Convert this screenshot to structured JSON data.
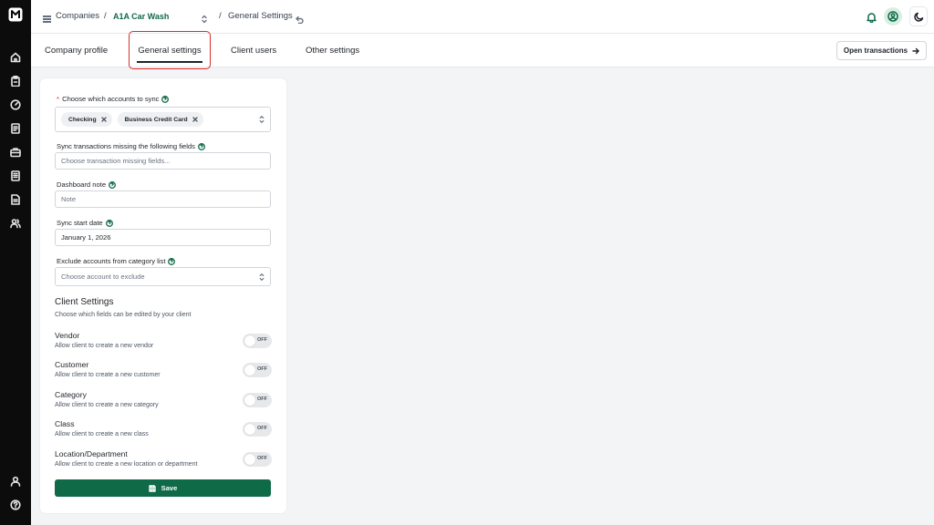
{
  "app": {
    "logo_icon": "brand-logo-icon",
    "accent_color": "#0f6a47",
    "highlight_color": "#d92d2d"
  },
  "sidebar": {
    "items": [
      {
        "name": "home",
        "icon": "home-icon"
      },
      {
        "name": "clipboard",
        "icon": "clipboard-icon"
      },
      {
        "name": "dashboard",
        "icon": "gauge-icon"
      },
      {
        "name": "reports",
        "icon": "document-icon"
      },
      {
        "name": "briefcase",
        "icon": "briefcase-icon"
      },
      {
        "name": "ledger",
        "icon": "ledger-icon"
      },
      {
        "name": "invoices",
        "icon": "file-text-icon"
      },
      {
        "name": "users",
        "icon": "users-icon"
      }
    ],
    "bottom_items": [
      {
        "name": "profile",
        "icon": "user-icon"
      },
      {
        "name": "help",
        "icon": "help-circle-icon"
      }
    ]
  },
  "header": {
    "breadcrumb_root": "Companies",
    "separator": "/",
    "company": "A1A Car Wash",
    "page": "General Settings"
  },
  "tabs": [
    {
      "label": "Company profile",
      "active": false
    },
    {
      "label": "General settings",
      "active": true
    },
    {
      "label": "Client users",
      "active": false
    },
    {
      "label": "Other settings",
      "active": false
    }
  ],
  "actions": {
    "open_transactions": "Open transactions"
  },
  "form": {
    "accounts": {
      "required_mark": "*",
      "label": "Choose which accounts to sync",
      "chips": [
        "Checking",
        "Business Credit Card"
      ]
    },
    "missing_fields": {
      "label": "Sync transactions missing the following fields",
      "placeholder": "Choose transaction missing fields..."
    },
    "dashboard_note": {
      "label": "Dashboard note",
      "placeholder": "Note"
    },
    "sync_start": {
      "label": "Sync start date",
      "value": "January 1, 2026"
    },
    "exclude": {
      "label": "Exclude accounts from category list",
      "placeholder": "Choose account to exclude"
    }
  },
  "client_settings": {
    "title": "Client Settings",
    "subtitle": "Choose which fields can be edited by your client",
    "toggles": [
      {
        "title": "Vendor",
        "desc": "Allow client to create a new vendor",
        "state": "OFF"
      },
      {
        "title": "Customer",
        "desc": "Allow client to create a new customer",
        "state": "OFF"
      },
      {
        "title": "Category",
        "desc": "Allow client to create a new category",
        "state": "OFF"
      },
      {
        "title": "Class",
        "desc": "Allow client to create a new class",
        "state": "OFF"
      },
      {
        "title": "Location/Department",
        "desc": "Allow client to create a new location or department",
        "state": "OFF"
      }
    ]
  },
  "save": {
    "label": "Save"
  }
}
